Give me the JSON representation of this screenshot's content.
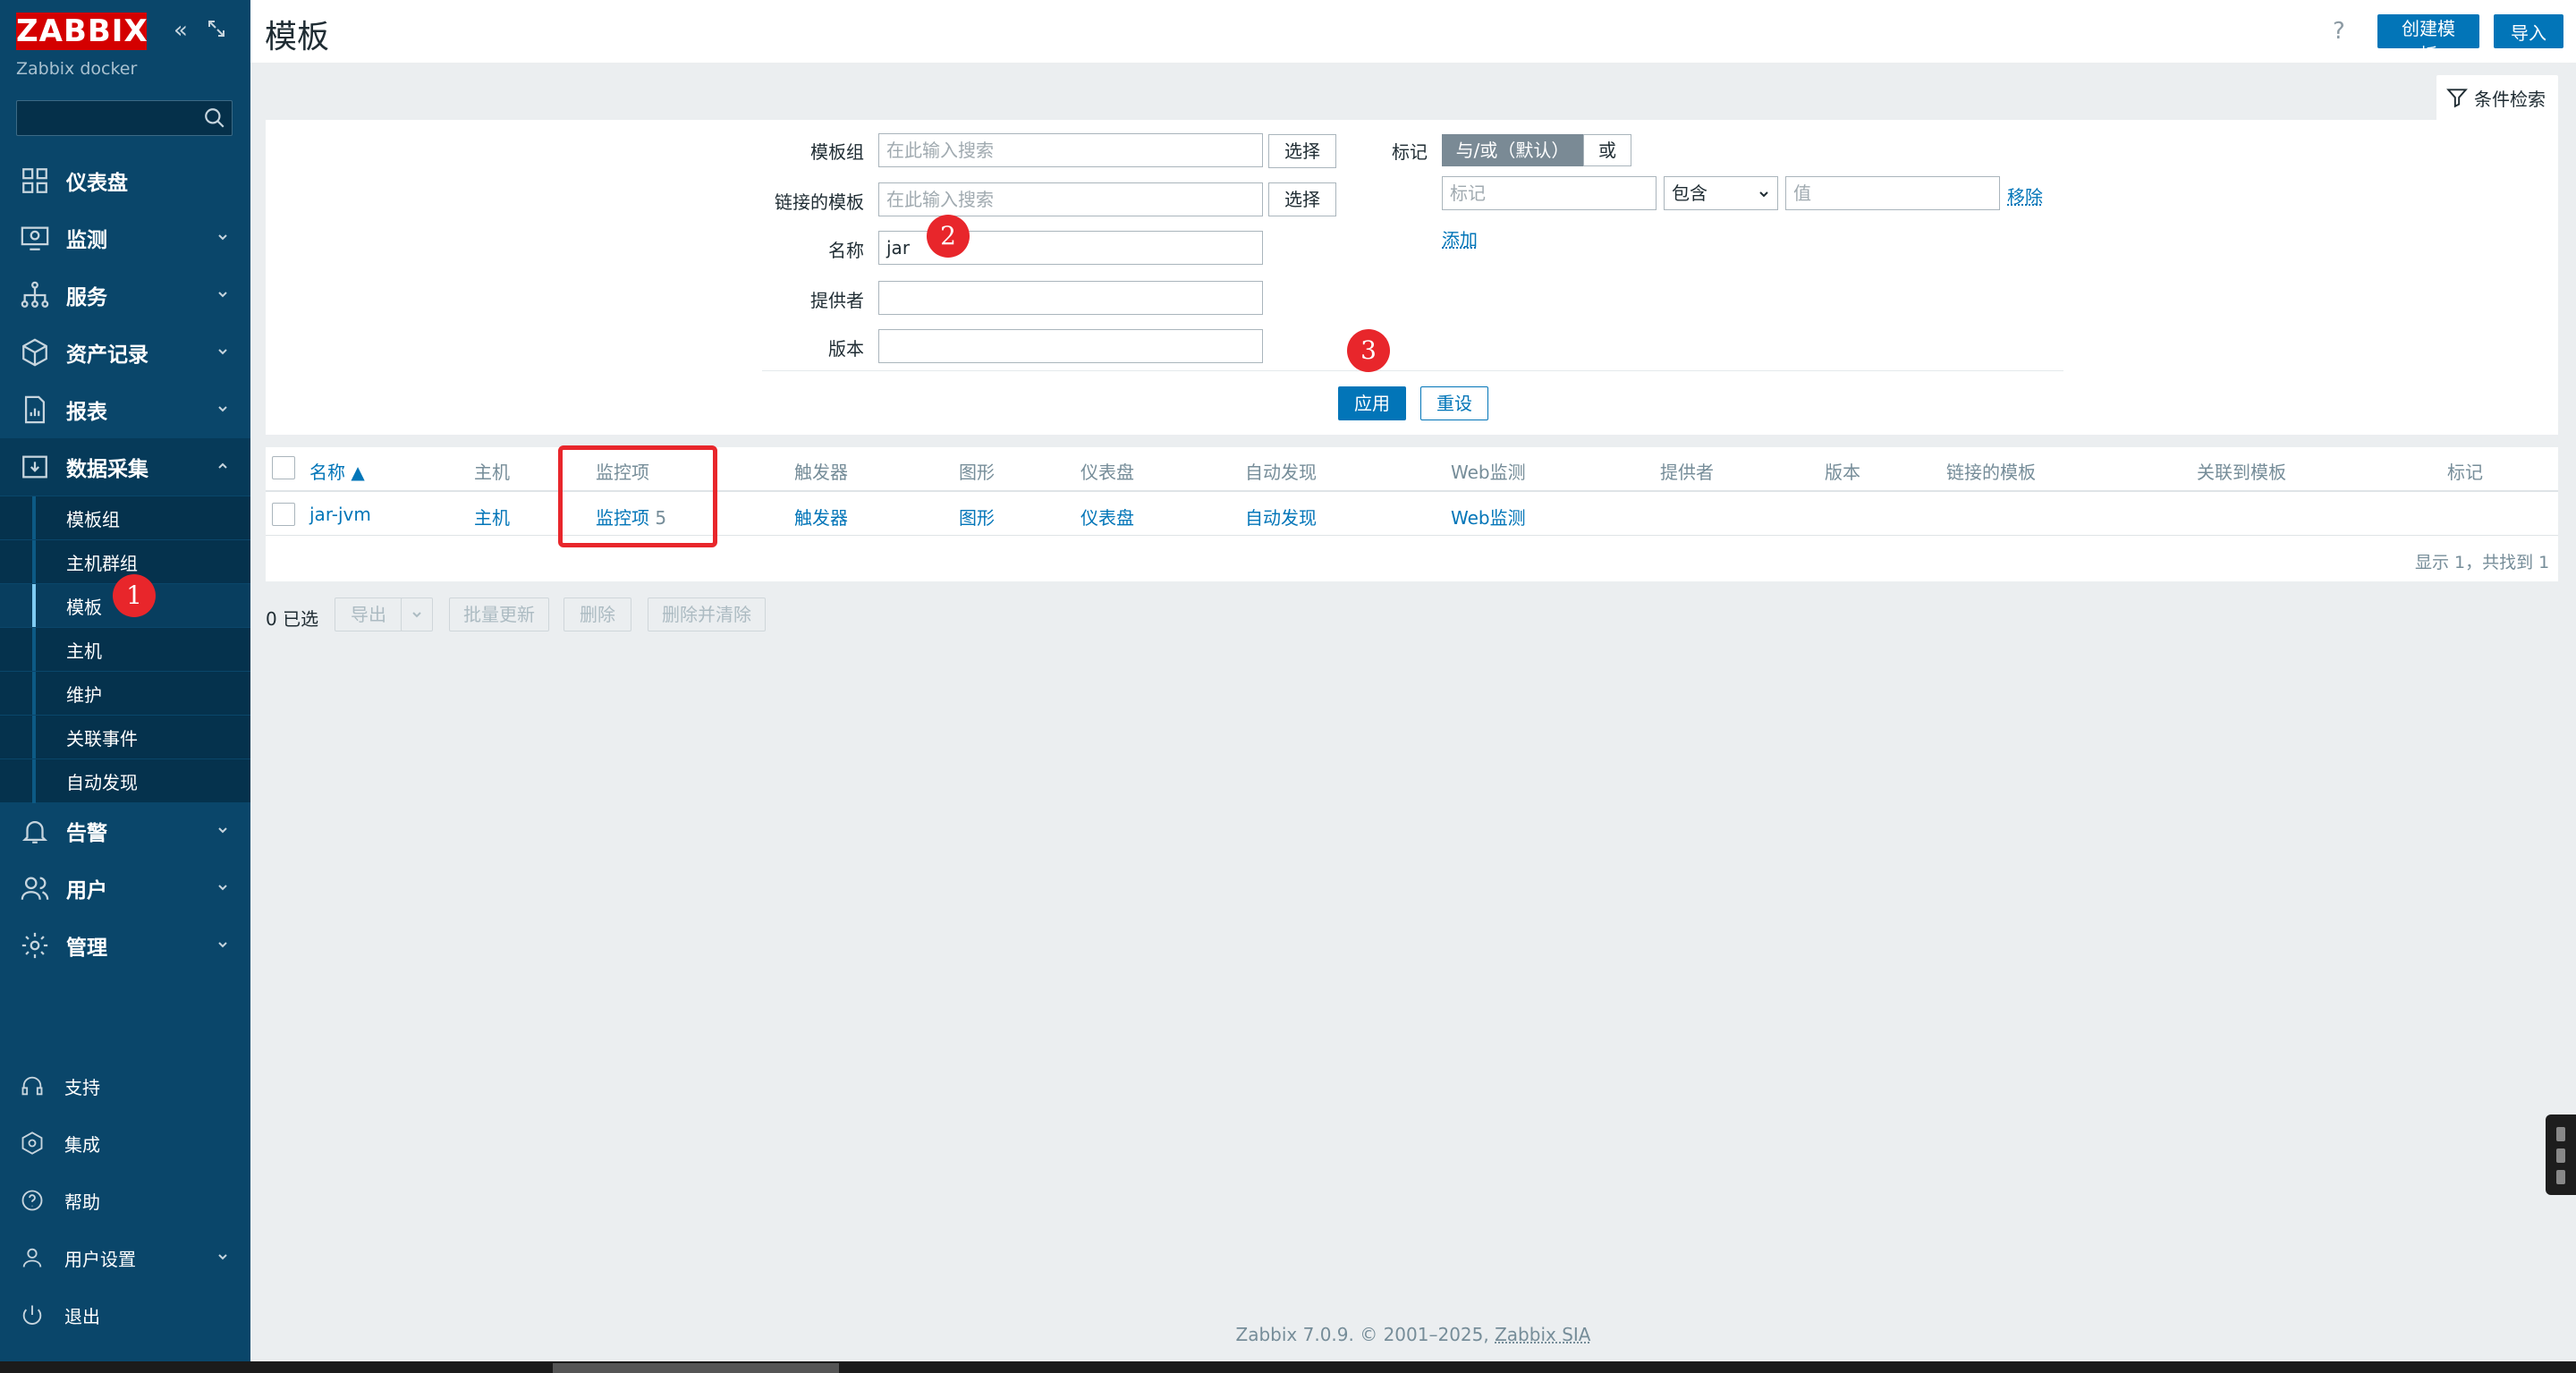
{
  "app": {
    "logo": "ZABBIX",
    "server_name": "Zabbix docker"
  },
  "nav": {
    "items": [
      {
        "label": "仪表盘",
        "icon": "dashboard-icon"
      },
      {
        "label": "监测",
        "icon": "monitoring-icon"
      },
      {
        "label": "服务",
        "icon": "services-icon"
      },
      {
        "label": "资产记录",
        "icon": "inventory-icon"
      },
      {
        "label": "报表",
        "icon": "reports-icon"
      },
      {
        "label": "数据采集",
        "icon": "data-collection-icon"
      },
      {
        "label": "告警",
        "icon": "alerts-icon"
      },
      {
        "label": "用户",
        "icon": "users-icon"
      },
      {
        "label": "管理",
        "icon": "administration-icon"
      }
    ],
    "sub_items": [
      "模板组",
      "主机群组",
      "模板",
      "主机",
      "维护",
      "关联事件",
      "自动发现"
    ],
    "bottom": [
      {
        "label": "支持",
        "icon": "support-icon"
      },
      {
        "label": "集成",
        "icon": "integrations-icon"
      },
      {
        "label": "帮助",
        "icon": "help-icon"
      },
      {
        "label": "用户设置",
        "icon": "user-settings-icon"
      },
      {
        "label": "退出",
        "icon": "signout-icon"
      }
    ]
  },
  "header": {
    "title": "模板",
    "help": "?",
    "create_button": "创建模板",
    "import_button": "导入"
  },
  "filter": {
    "tab_label": "条件检索",
    "template_group_label": "模板组",
    "template_group_placeholder": "在此输入搜索",
    "linked_templates_label": "链接的模板",
    "linked_templates_placeholder": "在此输入搜索",
    "select_button": "选择",
    "name_label": "名称",
    "name_value": "jar",
    "vendor_label": "提供者",
    "version_label": "版本",
    "tags_label": "标记",
    "tag_and_or": "与/或（默认）",
    "tag_or": "或",
    "tag_placeholder": "标记",
    "tag_operator": "包含",
    "tag_value_placeholder": "值",
    "remove_link": "移除",
    "add_link": "添加",
    "apply_button": "应用",
    "reset_button": "重设"
  },
  "table": {
    "headers": [
      "名称 ▲",
      "主机",
      "监控项",
      "触发器",
      "图形",
      "仪表盘",
      "自动发现",
      "Web监测",
      "提供者",
      "版本",
      "链接的模板",
      "关联到模板",
      "标记"
    ],
    "row": {
      "name": "jar-jvm",
      "hosts": "主机",
      "items": "监控项",
      "items_count": "5",
      "triggers": "触发器",
      "graphs": "图形",
      "dashboards": "仪表盘",
      "discovery": "自动发现",
      "web": "Web监测"
    },
    "summary": "显示 1，共找到 1"
  },
  "actions": {
    "selected": "0 已选",
    "export": "导出",
    "mass_update": "批量更新",
    "delete": "删除",
    "delete_clear": "删除并清除"
  },
  "annotations": [
    "1",
    "2",
    "3"
  ],
  "footer": {
    "text": "Zabbix 7.0.9. © 2001–2025, ",
    "link": "Zabbix SIA"
  },
  "colors": {
    "sidebar": "#0a466a",
    "accent": "#0275b8",
    "annotation": "#e8262b",
    "logo": "#d40000"
  }
}
